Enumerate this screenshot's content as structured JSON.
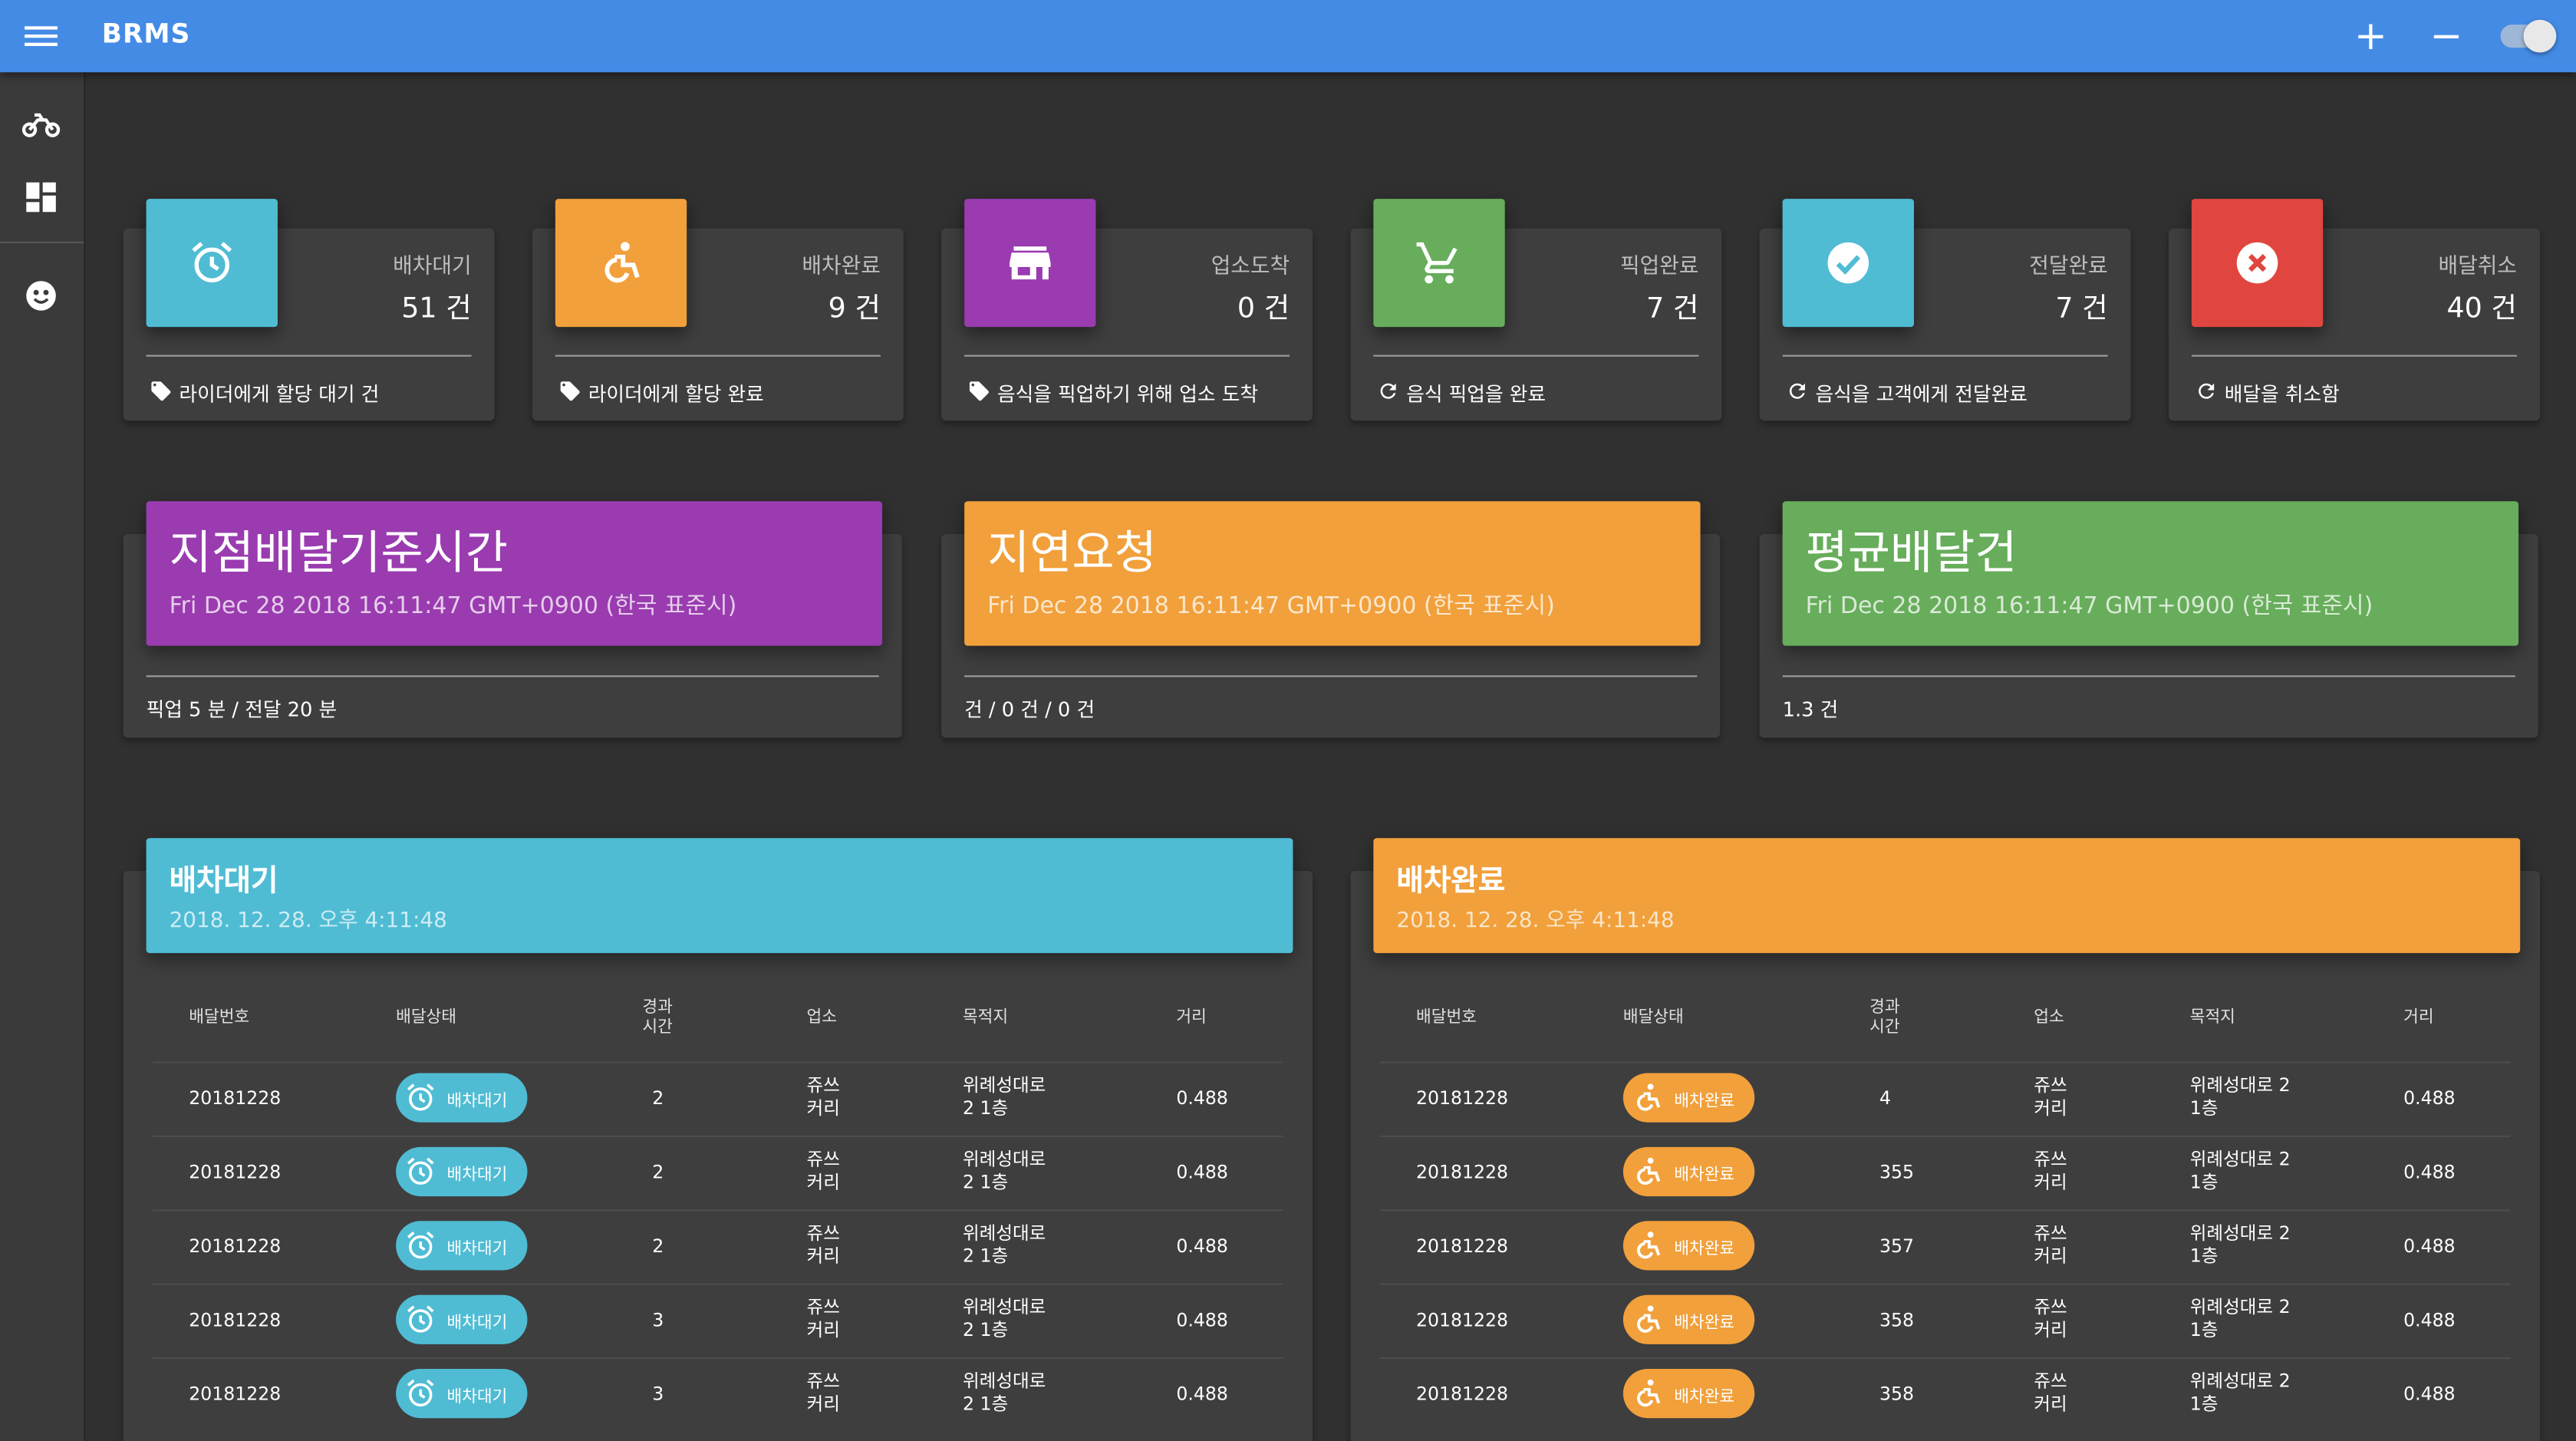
{
  "appbar": {
    "title": "BRMS",
    "plus": "+",
    "minus": "−"
  },
  "stats": [
    {
      "label": "배차대기",
      "value": "51 건",
      "foot": "라이더에게 할당 대기 건",
      "color": "#4fbcd4",
      "icon": "alarm-icon",
      "foot_icon": "tag-icon"
    },
    {
      "label": "배차완료",
      "value": "9 건",
      "foot": "라이더에게 할당 완료",
      "color": "#f1a03b",
      "icon": "accessible-icon",
      "foot_icon": "tag-icon"
    },
    {
      "label": "업소도착",
      "value": "0 건",
      "foot": "음식을 픽업하기 위해 업소 도착",
      "color": "#9a3bb0",
      "icon": "store-icon",
      "foot_icon": "tag-icon"
    },
    {
      "label": "픽업완료",
      "value": "7 건",
      "foot": "음식 픽업을 완료",
      "color": "#67ad5b",
      "icon": "cart-icon",
      "foot_icon": "refresh-icon"
    },
    {
      "label": "전달완료",
      "value": "7 건",
      "foot": "음식을 고객에게 전달완료",
      "color": "#4fbcd4",
      "icon": "check-circle-icon",
      "foot_icon": "refresh-icon"
    },
    {
      "label": "배달취소",
      "value": "40 건",
      "foot": "배달을 취소함",
      "color": "#e0463f",
      "icon": "cancel-icon",
      "foot_icon": "refresh-icon"
    }
  ],
  "summaries": [
    {
      "title": "지점배달기준시간",
      "date": "Fri Dec 28 2018 16:11:47 GMT+0900 (한국 표준시)",
      "foot": "픽업 5 분 / 전달 20 분",
      "color": "#9a3bb0"
    },
    {
      "title": "지연요청",
      "date": "Fri Dec 28 2018 16:11:47 GMT+0900 (한국 표준시)",
      "foot": "건 / 0 건 / 0 건",
      "color": "#f1a03b"
    },
    {
      "title": "평균배달건",
      "date": "Fri Dec 28 2018 16:11:47 GMT+0900 (한국 표준시)",
      "foot": "1.3 건",
      "color": "#67ad5b"
    }
  ],
  "tables": [
    {
      "title": "배차대기",
      "date": "2018. 12. 28. 오후 4:11:48",
      "color": "#4fbcd4",
      "status_icon": "alarm-icon",
      "headers": {
        "order": "배달번호",
        "status": "배달상태",
        "elapsed_1": "경과",
        "elapsed_2": "시간",
        "store": "업소",
        "dest": "목적지",
        "dist": "거리"
      },
      "rows": [
        {
          "order": "20181228",
          "status": "배차대기",
          "elapsed": "2",
          "store_1": "쥬쓰",
          "store_2": "커리",
          "dest_1": "위례성대로",
          "dest_2": "2 1층",
          "dist": "0.488"
        },
        {
          "order": "20181228",
          "status": "배차대기",
          "elapsed": "2",
          "store_1": "쥬쓰",
          "store_2": "커리",
          "dest_1": "위례성대로",
          "dest_2": "2 1층",
          "dist": "0.488"
        },
        {
          "order": "20181228",
          "status": "배차대기",
          "elapsed": "2",
          "store_1": "쥬쓰",
          "store_2": "커리",
          "dest_1": "위례성대로",
          "dest_2": "2 1층",
          "dist": "0.488"
        },
        {
          "order": "20181228",
          "status": "배차대기",
          "elapsed": "3",
          "store_1": "쥬쓰",
          "store_2": "커리",
          "dest_1": "위례성대로",
          "dest_2": "2 1층",
          "dist": "0.488"
        },
        {
          "order": "20181228",
          "status": "배차대기",
          "elapsed": "3",
          "store_1": "쥬쓰",
          "store_2": "커리",
          "dest_1": "위례성대로",
          "dest_2": "2 1층",
          "dist": "0.488"
        }
      ]
    },
    {
      "title": "배차완료",
      "date": "2018. 12. 28. 오후 4:11:48",
      "color": "#f1a03b",
      "status_icon": "accessible-icon",
      "headers": {
        "order": "배달번호",
        "status": "배달상태",
        "elapsed_1": "경과",
        "elapsed_2": "시간",
        "store": "업소",
        "dest": "목적지",
        "dist": "거리"
      },
      "rows": [
        {
          "order": "20181228",
          "status": "배차완료",
          "elapsed": "4",
          "store_1": "쥬쓰",
          "store_2": "커리",
          "dest_1": "위례성대로 2",
          "dest_2": "1층",
          "dist": "0.488"
        },
        {
          "order": "20181228",
          "status": "배차완료",
          "elapsed": "355",
          "store_1": "쥬쓰",
          "store_2": "커리",
          "dest_1": "위례성대로 2",
          "dest_2": "1층",
          "dist": "0.488"
        },
        {
          "order": "20181228",
          "status": "배차완료",
          "elapsed": "357",
          "store_1": "쥬쓰",
          "store_2": "커리",
          "dest_1": "위례성대로 2",
          "dest_2": "1층",
          "dist": "0.488"
        },
        {
          "order": "20181228",
          "status": "배차완료",
          "elapsed": "358",
          "store_1": "쥬쓰",
          "store_2": "커리",
          "dest_1": "위례성대로 2",
          "dest_2": "1층",
          "dist": "0.488"
        },
        {
          "order": "20181228",
          "status": "배차완료",
          "elapsed": "358",
          "store_1": "쥬쓰",
          "store_2": "커리",
          "dest_1": "위례성대로 2",
          "dest_2": "1층",
          "dist": "0.488"
        }
      ]
    }
  ]
}
